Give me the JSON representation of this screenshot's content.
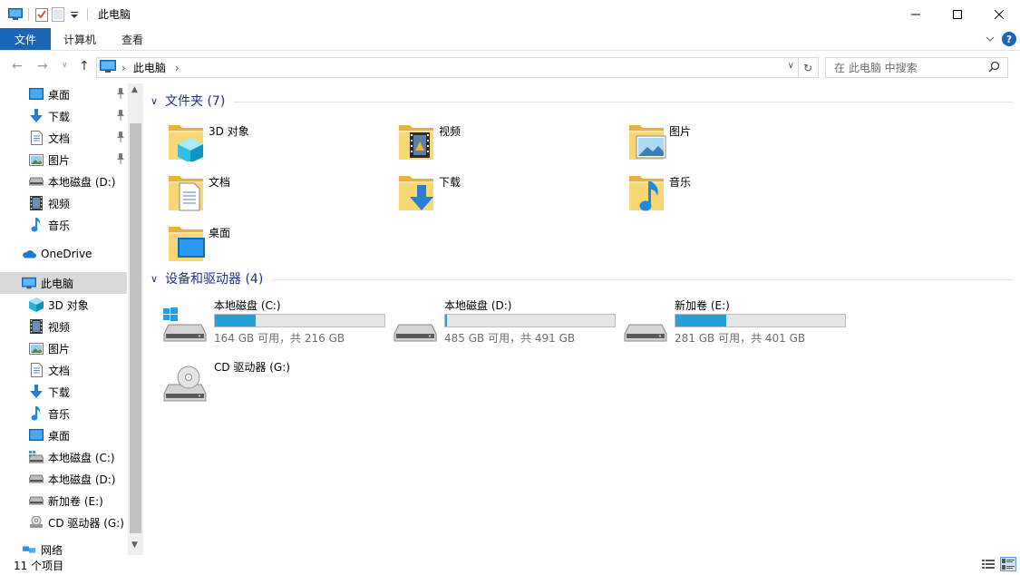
{
  "window": {
    "title": "此电脑",
    "controls": [
      "minimize",
      "maximize",
      "close"
    ]
  },
  "ribbon": {
    "tabs": [
      "文件",
      "计算机",
      "查看"
    ],
    "help_label": "?"
  },
  "address_bar": {
    "path": [
      "此电脑"
    ],
    "search_placeholder": "在 此电脑 中搜索"
  },
  "navigation": {
    "quick_access": [
      {
        "label": "桌面",
        "icon": "desktop-icon",
        "pinned": true
      },
      {
        "label": "下载",
        "icon": "download-icon",
        "pinned": true
      },
      {
        "label": "文档",
        "icon": "document-icon",
        "pinned": true
      },
      {
        "label": "图片",
        "icon": "picture-icon",
        "pinned": true
      },
      {
        "label": "本地磁盘 (D:)",
        "icon": "drive-icon",
        "pinned": false
      },
      {
        "label": "视频",
        "icon": "video-icon",
        "pinned": false
      },
      {
        "label": "音乐",
        "icon": "music-icon",
        "pinned": false
      }
    ],
    "onedrive": "OneDrive",
    "this_pc": "此电脑",
    "this_pc_children": [
      {
        "label": "3D 对象",
        "icon": "3d-objects-icon"
      },
      {
        "label": "视频",
        "icon": "video-icon"
      },
      {
        "label": "图片",
        "icon": "picture-icon"
      },
      {
        "label": "文档",
        "icon": "document-icon"
      },
      {
        "label": "下载",
        "icon": "download-icon"
      },
      {
        "label": "音乐",
        "icon": "music-icon"
      },
      {
        "label": "桌面",
        "icon": "desktop-icon"
      },
      {
        "label": "本地磁盘 (C:)",
        "icon": "windows-drive-icon"
      },
      {
        "label": "本地磁盘 (D:)",
        "icon": "drive-icon"
      },
      {
        "label": "新加卷 (E:)",
        "icon": "drive-icon"
      },
      {
        "label": "CD 驱动器 (G:)",
        "icon": "cd-drive-icon"
      }
    ],
    "network": "网络"
  },
  "content": {
    "folders_header": "文件夹 (7)",
    "folders": [
      {
        "label": "3D 对象",
        "icon": "3d-objects-folder-icon"
      },
      {
        "label": "视频",
        "icon": "video-folder-icon"
      },
      {
        "label": "图片",
        "icon": "picture-folder-icon"
      },
      {
        "label": "文档",
        "icon": "document-folder-icon"
      },
      {
        "label": "下载",
        "icon": "download-folder-icon"
      },
      {
        "label": "音乐",
        "icon": "music-folder-icon"
      },
      {
        "label": "桌面",
        "icon": "desktop-folder-icon"
      }
    ],
    "devices_header": "设备和驱动器 (4)",
    "drives": [
      {
        "label": "本地磁盘 (C:)",
        "free_text": "164 GB 可用，共 216 GB",
        "used_fraction": 0.24,
        "icon": "windows-drive-icon"
      },
      {
        "label": "本地磁盘 (D:)",
        "free_text": "485 GB 可用，共 491 GB",
        "used_fraction": 0.012,
        "icon": "drive-icon"
      },
      {
        "label": "新加卷 (E:)",
        "free_text": "281 GB 可用，共 401 GB",
        "used_fraction": 0.3,
        "icon": "drive-icon"
      },
      {
        "label": "CD 驱动器 (G:)",
        "free_text": "",
        "used_fraction": null,
        "icon": "cd-drive-icon"
      }
    ]
  },
  "status_bar": {
    "item_count": "11 个项目"
  },
  "colors": {
    "accent": "#1a65b7",
    "group_header": "#1e3287",
    "drive_fill": "#26a0da",
    "folder": "#f4c559"
  }
}
